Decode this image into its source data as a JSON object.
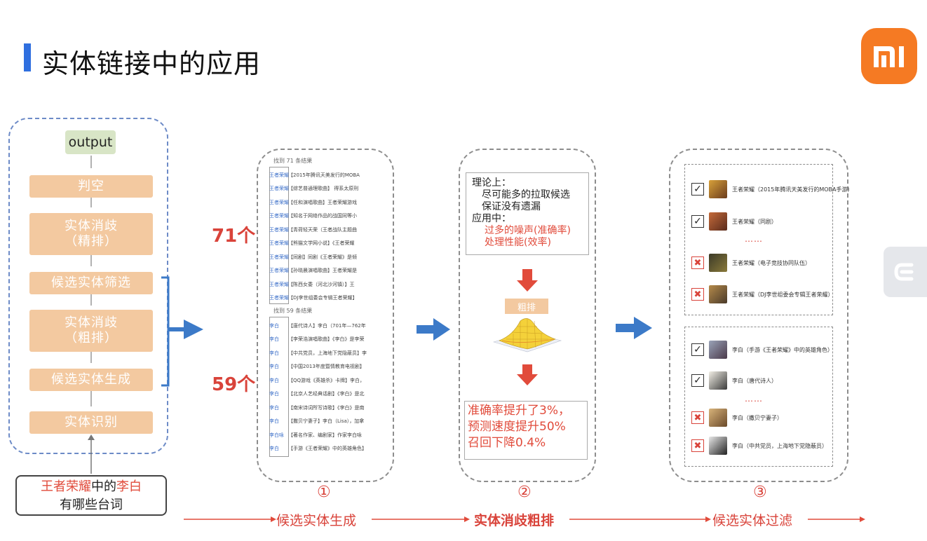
{
  "slide": {
    "title": "实体链接中的应用"
  },
  "pipeline": {
    "output": "output",
    "stages": [
      "判空",
      "实体消歧\n（精排）",
      "候选实体筛选",
      "实体消歧\n（粗排）",
      "候选实体生成",
      "实体识别"
    ],
    "query_line1_parts": [
      "王者荣耀",
      "中的",
      "李白"
    ],
    "query_line2": "有哪些台词"
  },
  "panel1": {
    "count_a": "71个",
    "count_b": "59个",
    "header_a": "找到 71 条结果",
    "header_b": "找到 59 条结果",
    "rows_a": [
      {
        "tag": "王者荣耀",
        "text": "【2015年腾讯天美发行的MOBA"
      },
      {
        "tag": "王者荣耀",
        "text": "【综艺普通理歌曲】 得系太原刑"
      },
      {
        "tag": "王者荣耀",
        "text": "【任和演唱歌曲】王者荣耀游戏"
      },
      {
        "tag": "王者荣耀",
        "text": "【知名于网络作品的战国同等小"
      },
      {
        "tag": "王者荣耀",
        "text": "【青荷轻天荣（王者战队主题曲"
      },
      {
        "tag": "王者荣耀",
        "text": "【熊猫文学网小说】《王者荣耀"
      },
      {
        "tag": "王者荣耀",
        "text": "【同剧】同剧《王者荣耀》是倾"
      },
      {
        "tag": "王者荣耀",
        "text": "【孙晓晨演唱歌曲】王者荣耀是"
      },
      {
        "tag": "王者荣耀",
        "text": "【陈西女委（河北沙河镇）】王"
      },
      {
        "tag": "王者荣耀",
        "text": "【DJ李世组委会专辑王者荣耀】"
      }
    ],
    "rows_b": [
      {
        "tag": "李白",
        "text": "【唐代诗人】李白（701年—762年"
      },
      {
        "tag": "李白",
        "text": "【李荣浩演唱歌曲】《李白》是李荣"
      },
      {
        "tag": "李白",
        "text": "【中共党员，上海地下党隐蔽员】李"
      },
      {
        "tag": "李白",
        "text": "【中国2013年度暨情教育电视剧】"
      },
      {
        "tag": "李白",
        "text": "【QQ游戏《英雄杀》卡牌】李白，"
      },
      {
        "tag": "李白",
        "text": "【北京人艺经典话剧】《李白》是北"
      },
      {
        "tag": "李白",
        "text": "【南宋诗词所写诗歌】《李白》是南"
      },
      {
        "tag": "李白",
        "text": "【撒贝宁妻子】李白（Lisa），加拿"
      },
      {
        "tag": "李白咏",
        "text": "【著名作家、编剧家】作家李白咏"
      },
      {
        "tag": "李白",
        "text": "【手游《王者荣耀》中的英雄角色】"
      }
    ],
    "step_num": "①",
    "step_label": "候选实体生成"
  },
  "panel2": {
    "theory_lines": [
      "理论上：",
      "尽可能多的拉取候选",
      "保证没有遗漏",
      "应用中：",
      "过多的噪声(准确率)",
      "处理性能(效率)"
    ],
    "coarse_label": "粗排",
    "result_lines": [
      "准确率提升了3%，",
      "预测速度提升50%",
      "召回下降0.4%"
    ],
    "step_num": "②",
    "step_label": "实体消歧粗排"
  },
  "panel3": {
    "group_a": [
      {
        "mark": "check",
        "text": "王者荣耀（2015年腾讯天美发行的MOBA手游）"
      },
      {
        "mark": "check",
        "text": "王者荣耀（同剧）"
      },
      {
        "mark": "cross",
        "text": "王者荣耀（电子竞技协同队伍）"
      },
      {
        "mark": "cross",
        "text": "王者荣耀（DJ李世组委会专辑王者荣耀）"
      }
    ],
    "group_b": [
      {
        "mark": "check",
        "text": "李白（手游《王者荣耀》中的英雄角色）"
      },
      {
        "mark": "check",
        "text": "李白（唐代诗人）"
      },
      {
        "mark": "cross",
        "text": "李白（撒贝宁妻子）"
      },
      {
        "mark": "cross",
        "text": "李白（中共党员，上海地下党隐蔽员）"
      }
    ],
    "dots": "……",
    "step_num": "③",
    "step_label": "候选实体过滤"
  },
  "colors": {
    "accent_blue": "#2f6fdf",
    "arrow_blue": "#3c7ac8",
    "stage_fill": "#f3c9a0",
    "output_fill": "#d8e5c6",
    "highlight_red": "#d9433a",
    "logo_orange": "#f57a23"
  }
}
